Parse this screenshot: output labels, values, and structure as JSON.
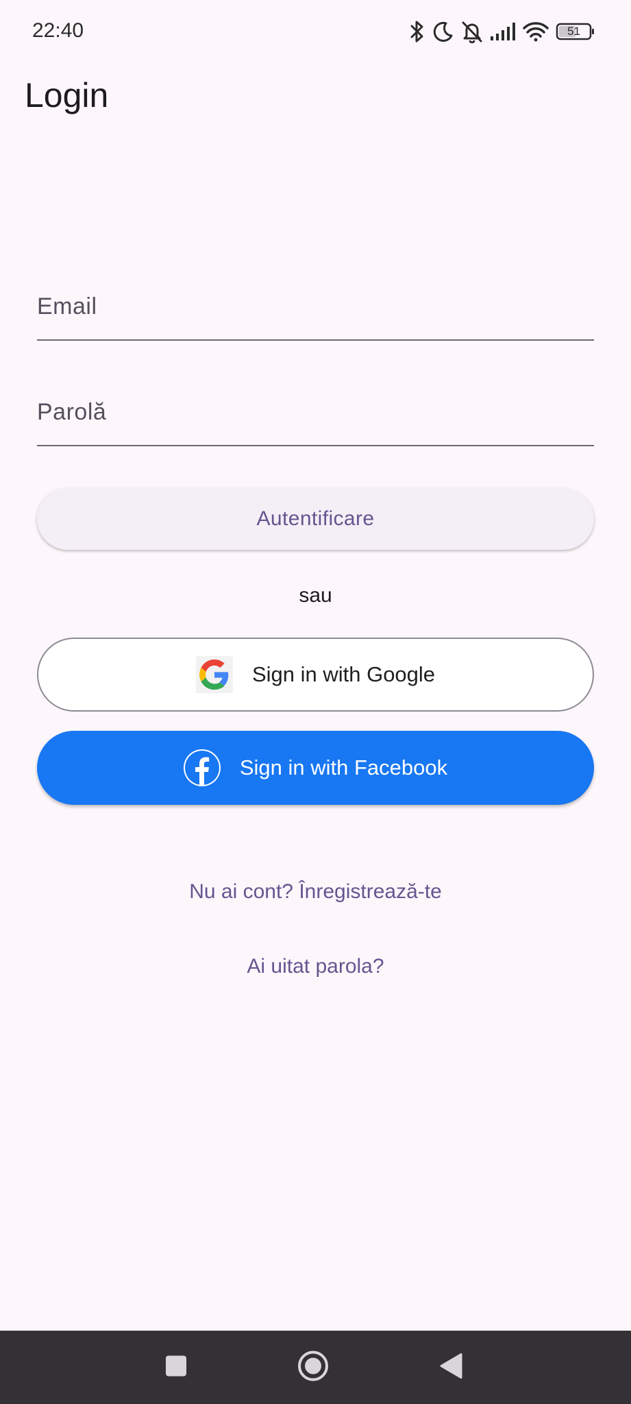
{
  "status_bar": {
    "time": "22:40",
    "battery": "51",
    "icons": [
      "bluetooth-icon",
      "moon-icon",
      "bell-off-icon",
      "signal-icon",
      "wifi-icon",
      "battery-icon"
    ]
  },
  "app_bar": {
    "title": "Login"
  },
  "form": {
    "email_placeholder": "Email",
    "email_value": "",
    "password_placeholder": "Parolă",
    "password_value": "",
    "login_label": "Autentificare",
    "or_label": "sau"
  },
  "social": {
    "google_label": "Sign in with Google",
    "facebook_label": "Sign in with Facebook"
  },
  "links": {
    "register": "Nu ai cont? Înregistrează-te",
    "forgot": "Ai uitat parola?"
  },
  "nav_bar": {
    "items": [
      "recents-icon",
      "home-icon",
      "back-icon"
    ]
  },
  "colors": {
    "background": "#fdf7fc",
    "primary": "#65558f",
    "facebook": "#1877f2",
    "nav_bar": "#333135"
  }
}
